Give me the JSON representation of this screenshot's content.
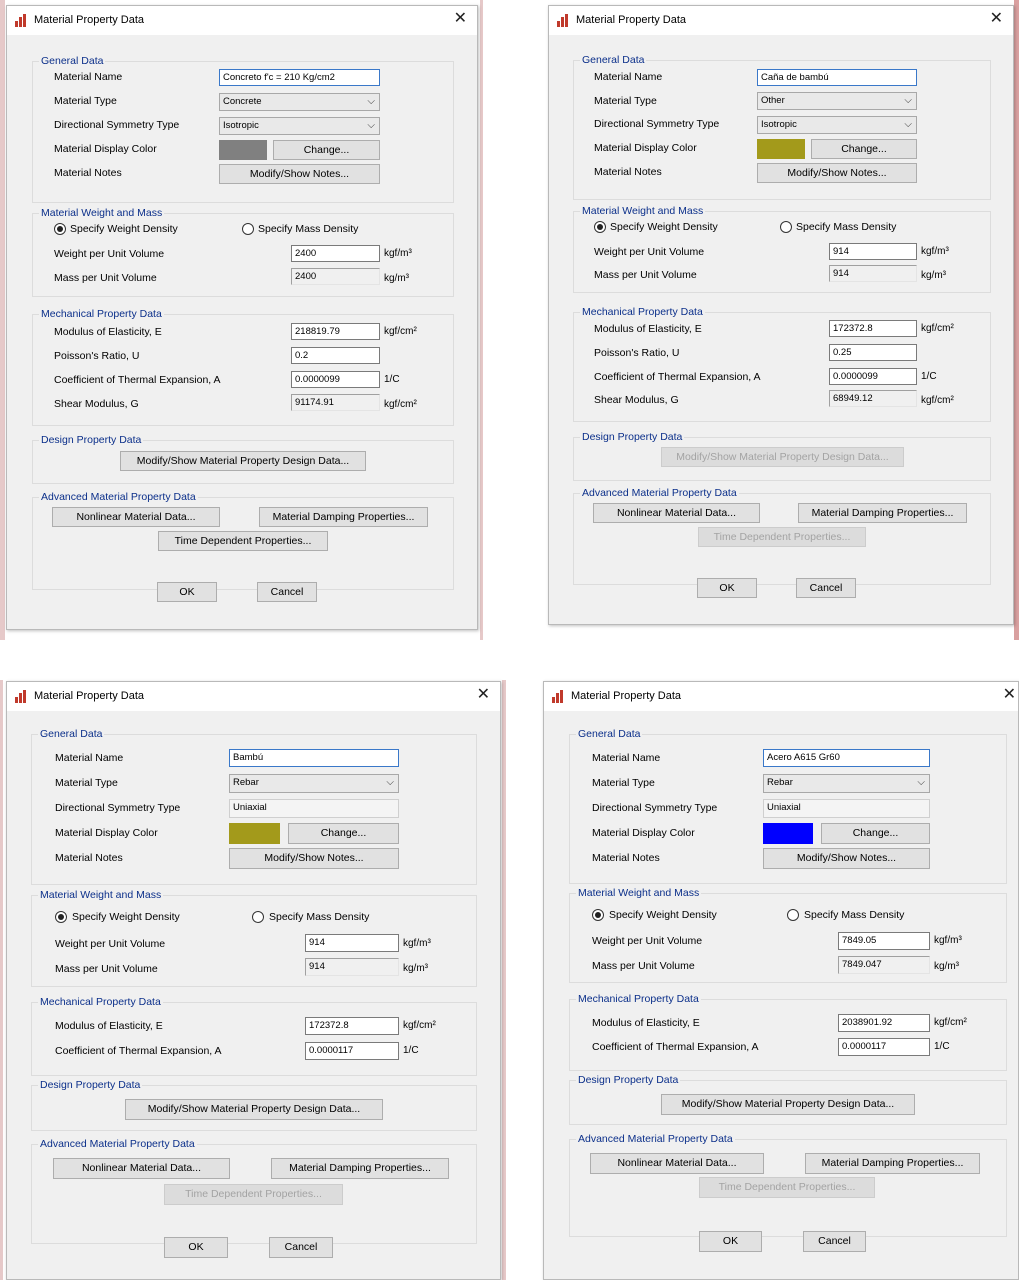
{
  "common": {
    "window_title": "Material Property Data",
    "close_glyph": "✕",
    "chevron": "⌵",
    "groups": {
      "general": "General Data",
      "weight_mass": "Material Weight and Mass",
      "mechanical": "Mechanical Property Data",
      "design": "Design Property Data",
      "advanced": "Advanced Material Property Data"
    },
    "labels": {
      "material_name": "Material Name",
      "material_type": "Material Type",
      "directional_symmetry": "Directional Symmetry Type",
      "display_color": "Material Display Color",
      "notes": "Material Notes",
      "specify_weight": "Specify Weight Density",
      "specify_mass": "Specify Mass Density",
      "weight_per_volume": "Weight per Unit Volume",
      "mass_per_volume": "Mass per Unit Volume",
      "modulus": "Modulus of Elasticity,  E",
      "poisson": "Poisson's Ratio,  U",
      "thermal": "Coefficient of Thermal Expansion,  A",
      "shear": "Shear Modulus,  G"
    },
    "buttons": {
      "change": "Change...",
      "notes": "Modify/Show Notes...",
      "design": "Modify/Show Material Property Design Data...",
      "nonlinear": "Nonlinear Material Data...",
      "damping": "Material Damping Properties...",
      "time": "Time Dependent Properties...",
      "ok": "OK",
      "cancel": "Cancel"
    },
    "units": {
      "weight": "kgf/m³",
      "mass": "kg/m³",
      "stress": "kgf/cm²",
      "thermal": "1/C"
    }
  },
  "dialogs": [
    {
      "name": "Concreto f'c = 210 Kg/cm2",
      "type": "Concrete",
      "symmetry": "Isotropic",
      "color": "#808080",
      "weight": "2400",
      "mass": "2400",
      "modulus": "218819.79",
      "poisson": "0.2",
      "thermal": "0.0000099",
      "shear": "91174.91"
    },
    {
      "name": "Caña de bambú",
      "type": "Other",
      "symmetry": "Isotropic",
      "color": "#a39a1b",
      "weight": "914",
      "mass": "914",
      "modulus": "172372.8",
      "poisson": "0.25",
      "thermal": "0.0000099",
      "shear": "68949.12"
    },
    {
      "name": "Bambú",
      "type": "Rebar",
      "symmetry": "Uniaxial",
      "color": "#a39a1b",
      "weight": "914",
      "mass": "914",
      "modulus": "172372.8",
      "thermal": "0.0000117"
    },
    {
      "name": "Acero A615 Gr60",
      "type": "Rebar",
      "symmetry": "Uniaxial",
      "color": "#0000ff",
      "weight": "7849.05",
      "mass": "7849.047",
      "modulus": "2038901.92",
      "thermal": "0.0000117"
    }
  ]
}
